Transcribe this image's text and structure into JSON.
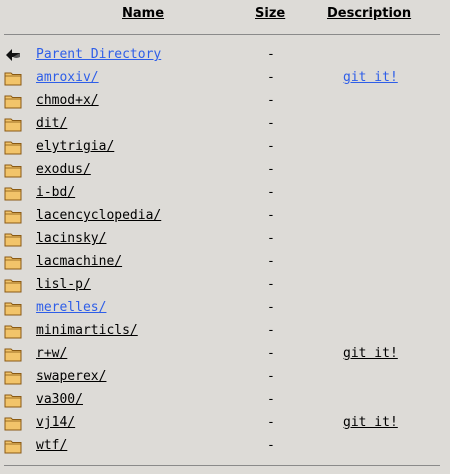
{
  "headers": {
    "name": "Name",
    "size": "Size",
    "description": "Description"
  },
  "rows": [
    {
      "icon": "back-arrow-icon",
      "name": "Parent Directory",
      "size": "-",
      "description": "",
      "name_link": true,
      "desc_link": false
    },
    {
      "icon": "folder-icon",
      "name": "amroxiv/",
      "size": "-",
      "description": "git it!",
      "name_link": true,
      "desc_link": true
    },
    {
      "icon": "folder-icon",
      "name": "chmod+x/",
      "size": "-",
      "description": "",
      "name_link": false,
      "desc_link": false
    },
    {
      "icon": "folder-icon",
      "name": "dit/",
      "size": "-",
      "description": "",
      "name_link": false,
      "desc_link": false
    },
    {
      "icon": "folder-icon",
      "name": "elytrigia/",
      "size": "-",
      "description": "",
      "name_link": false,
      "desc_link": false
    },
    {
      "icon": "folder-icon",
      "name": "exodus/",
      "size": "-",
      "description": "",
      "name_link": false,
      "desc_link": false
    },
    {
      "icon": "folder-icon",
      "name": "i-bd/",
      "size": "-",
      "description": "",
      "name_link": false,
      "desc_link": false
    },
    {
      "icon": "folder-icon",
      "name": "lacencyclopedia/",
      "size": "-",
      "description": "",
      "name_link": false,
      "desc_link": false
    },
    {
      "icon": "folder-icon",
      "name": "lacinsky/",
      "size": "-",
      "description": "",
      "name_link": false,
      "desc_link": false
    },
    {
      "icon": "folder-icon",
      "name": "lacmachine/",
      "size": "-",
      "description": "",
      "name_link": false,
      "desc_link": false
    },
    {
      "icon": "folder-icon",
      "name": "lisl-p/",
      "size": "-",
      "description": "",
      "name_link": false,
      "desc_link": false
    },
    {
      "icon": "folder-icon",
      "name": "merelles/",
      "size": "-",
      "description": "",
      "name_link": true,
      "desc_link": false
    },
    {
      "icon": "folder-icon",
      "name": "minimarticls/",
      "size": "-",
      "description": "",
      "name_link": false,
      "desc_link": false
    },
    {
      "icon": "folder-icon",
      "name": "r+w/",
      "size": "-",
      "description": "git it!",
      "name_link": false,
      "desc_link": false
    },
    {
      "icon": "folder-icon",
      "name": "swaperex/",
      "size": "-",
      "description": "",
      "name_link": false,
      "desc_link": false
    },
    {
      "icon": "folder-icon",
      "name": "va300/",
      "size": "-",
      "description": "",
      "name_link": false,
      "desc_link": false
    },
    {
      "icon": "folder-icon",
      "name": "vj14/",
      "size": "-",
      "description": "git it!",
      "name_link": false,
      "desc_link": false
    },
    {
      "icon": "folder-icon",
      "name": "wtf/",
      "size": "-",
      "description": "",
      "name_link": false,
      "desc_link": false
    }
  ],
  "colors": {
    "background": "#dddbd7",
    "link": "#2e5ee8",
    "folder": "#f2c46a",
    "folder_stroke": "#8a5a14"
  }
}
